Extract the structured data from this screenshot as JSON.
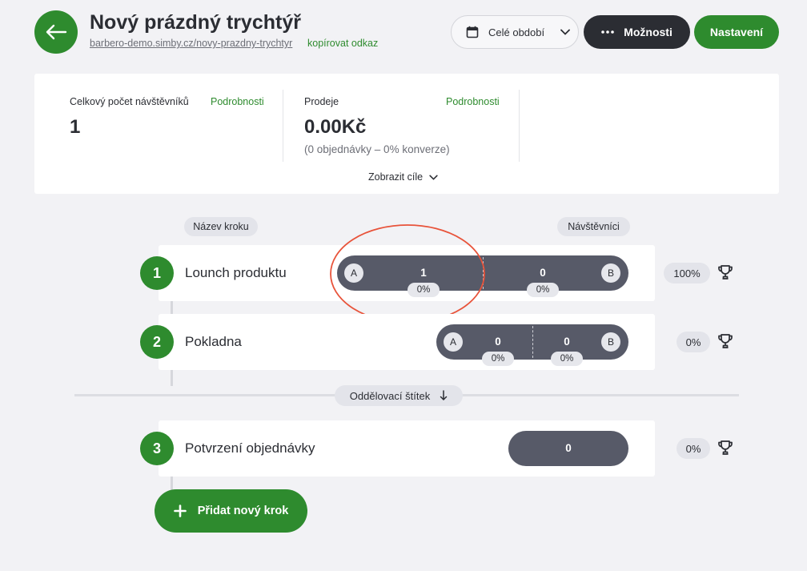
{
  "header": {
    "title": "Nový prázdný trychtýř",
    "url": "barbero-demo.simby.cz/novy-prazdny-trychtyr",
    "copy_link": "kopírovat odkaz",
    "period_label": "Celé období",
    "options_label": "Možnosti",
    "settings_label": "Nastavení"
  },
  "stats": {
    "visitors": {
      "label": "Celkový počet návštěvníků",
      "link": "Podrobnosti",
      "value": "1"
    },
    "sales": {
      "label": "Prodeje",
      "link": "Podrobnosti",
      "value": "0.00Kč",
      "sub": "(0 objednávky – 0% konverze)"
    },
    "show_goals": "Zobrazit cíle"
  },
  "columns": {
    "step_name": "Název kroku",
    "visitors": "Návštěvníci"
  },
  "steps": [
    {
      "num": "1",
      "name": "Lounch produktu",
      "a_label": "A",
      "b_label": "B",
      "a_value": "1",
      "a_pct": "0%",
      "b_value": "0",
      "b_pct": "0%",
      "conversion": "100%"
    },
    {
      "num": "2",
      "name": "Pokladna",
      "a_label": "A",
      "b_label": "B",
      "a_value": "0",
      "a_pct": "0%",
      "b_value": "0",
      "b_pct": "0%",
      "conversion": "0%"
    },
    {
      "num": "3",
      "name": "Potvrzení objednávky",
      "value": "0",
      "conversion": "0%"
    }
  ],
  "separator": {
    "label": "Oddělovací štítek"
  },
  "add_step": {
    "label": "Přidat nový krok"
  },
  "colors": {
    "green": "#2e8b2e",
    "dark": "#2b2d33",
    "bar": "#575a68",
    "highlight": "#e8533a"
  },
  "icons": {
    "back": "arrow-left-icon",
    "calendar": "calendar-icon",
    "chevron": "chevron-down-icon",
    "more": "more-dots-icon",
    "trophy": "trophy-icon",
    "plus": "plus-icon",
    "arrow_down": "arrow-down-icon"
  }
}
